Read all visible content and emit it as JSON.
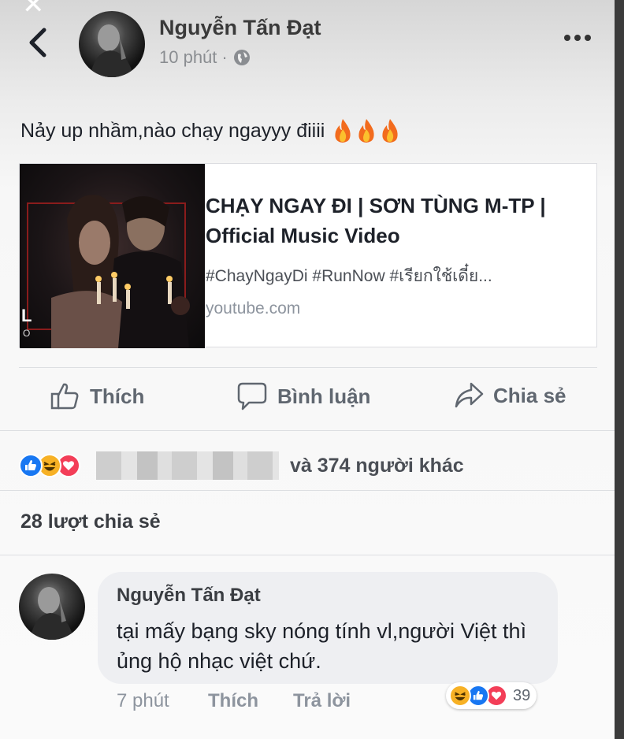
{
  "header": {
    "author": "Nguyễn Tấn Đạt",
    "time": "10 phút",
    "separator": "·"
  },
  "post": {
    "text": "Nảy up nhầm,nào chạy ngayyy điiii"
  },
  "link_card": {
    "title": "CHẠY NGAY ĐI | SƠN TÙNG M-TP | Official Music Video",
    "description": "#ChayNgayDi #RunNow #เรียกใช้เดี๋ย...",
    "domain": "youtube.com",
    "thumb_letters": "L",
    "thumb_letters2": "O"
  },
  "actions": {
    "like": "Thích",
    "comment": "Bình luận",
    "share": "Chia sẻ"
  },
  "reactions": {
    "summary": "và 374 người khác"
  },
  "shares": {
    "label": "28 lượt chia sẻ"
  },
  "comment": {
    "author": "Nguyễn Tấn Đạt",
    "text": "tại mấy bạng sky nóng tính vl,người Việt thì ủng hộ nhạc việt chứ.",
    "time": "7 phút",
    "like": "Thích",
    "reply": "Trả lời",
    "reaction_count": "39"
  },
  "colors": {
    "like_blue": "#1877f2",
    "love_red": "#f33e58",
    "haha_yellow": "#f7b125"
  }
}
